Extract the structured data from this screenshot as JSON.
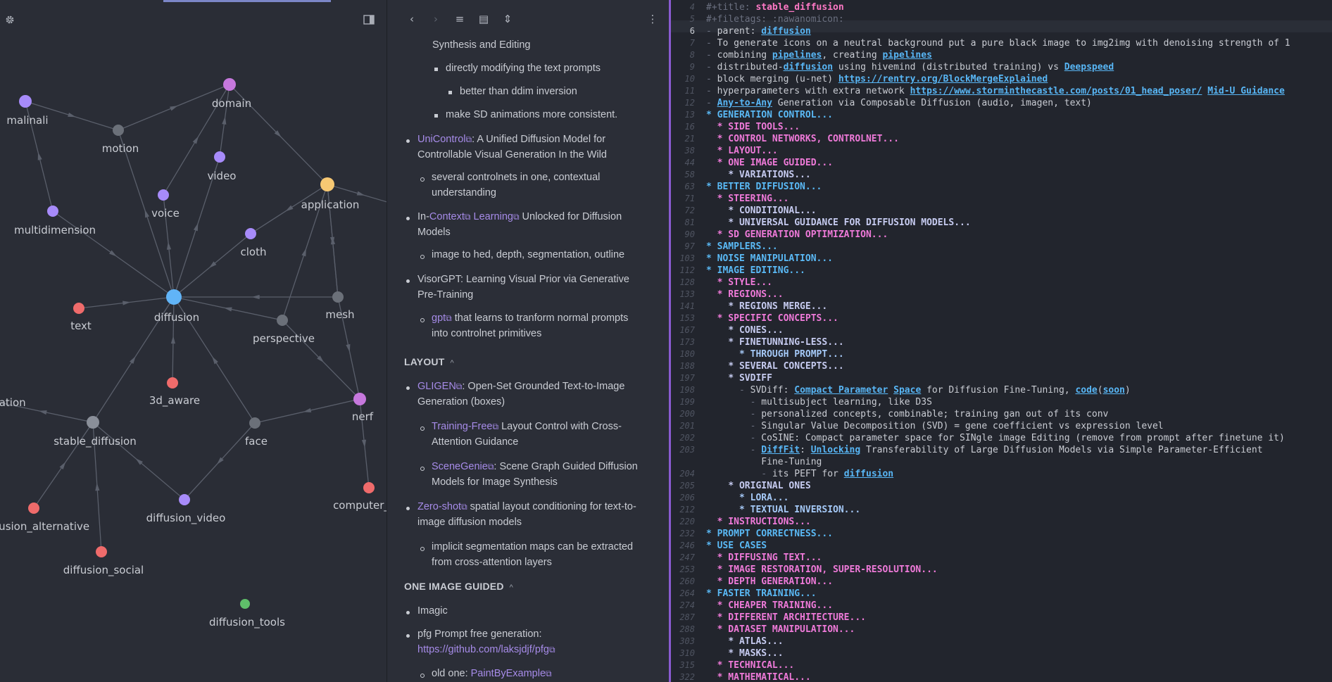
{
  "graph": {
    "settings_icon": "gear-icon",
    "sidebar_icon": "sidebar-toggle-icon",
    "nodes": [
      {
        "id": "malinali",
        "label": "malinali",
        "color": "#a78bfa"
      },
      {
        "id": "domain",
        "label": "domain",
        "color": "#c678dd"
      },
      {
        "id": "motion",
        "label": "motion",
        "color": "#6b7079"
      },
      {
        "id": "video",
        "label": "video",
        "color": "#a78bfa"
      },
      {
        "id": "voice",
        "label": "voice",
        "color": "#a78bfa"
      },
      {
        "id": "application",
        "label": "application",
        "color": "#f7c873"
      },
      {
        "id": "multidimension",
        "label": "multidimension",
        "color": "#a78bfa"
      },
      {
        "id": "cloth",
        "label": "cloth",
        "color": "#a78bfa"
      },
      {
        "id": "text",
        "label": "text",
        "color": "#ef6b6b"
      },
      {
        "id": "diffusion",
        "label": "diffusion",
        "color": "#61b4f7"
      },
      {
        "id": "mesh",
        "label": "mesh",
        "color": "#6b7079"
      },
      {
        "id": "perspective",
        "label": "perspective",
        "color": "#6b7079"
      },
      {
        "id": "3d_aware",
        "label": "3d_aware",
        "color": "#ef6b6b"
      },
      {
        "id": "ntation",
        "label": "ntation",
        "color": "#6b7079"
      },
      {
        "id": "nerf",
        "label": "nerf",
        "color": "#c678dd"
      },
      {
        "id": "stable_diffusion",
        "label": "stable_diffusion",
        "color": "#8a8f99"
      },
      {
        "id": "face",
        "label": "face",
        "color": "#6b7079"
      },
      {
        "id": "computer_illu",
        "label": "computer_illu",
        "color": "#ef6b6b"
      },
      {
        "id": "diffusion_video",
        "label": "diffusion_video",
        "color": "#a78bfa"
      },
      {
        "id": "fusion_alternative",
        "label": "fusion_alternative",
        "color": "#ef6b6b"
      },
      {
        "id": "diffusion_social",
        "label": "diffusion_social",
        "color": "#ef6b6b"
      },
      {
        "id": "diffusion_tools",
        "label": "diffusion_tools",
        "color": "#5fbf6a"
      }
    ]
  },
  "reader": {
    "toolbar": {
      "back": "‹",
      "forward": "›",
      "outline": "≡",
      "reading": "▤",
      "expand": "⇕",
      "more": "⋮"
    },
    "items": {
      "i1": "Synthesis and Editing",
      "i2": "directly modifying the text prompts",
      "i3": "better than ddim inversion",
      "i4": "make SD animations more consistent.",
      "i5_link": "UniControl",
      "i5_rest1": ": A Unified Diffusion Model for",
      "i5_rest2": "Controllable Visual Generation In the Wild",
      "i6a": "several controlnets in one, contextual",
      "i6b": "understanding",
      "i7_pre": "In-",
      "i7_link1": "Context",
      "i7_link2": "Learning",
      "i7_rest": " Unlocked for Diffusion",
      "i7_rest2": "Models",
      "i8": "image to hed, depth, segmentation, outline",
      "i9a": "VisorGPT: Learning Visual Prior via Generative",
      "i9b": "Pre-Training",
      "i10_link": "gpt",
      "i10_rest": " that learns to tranform normal prompts",
      "i10_rest2": "into controlnet primitives",
      "h_layout": "LAYOUT",
      "i11_link": "GLIGEN",
      "i11_rest": ": Open-Set Grounded Text-to-Image",
      "i11_rest2": "Generation (boxes)",
      "i12_link": "Training-Free",
      "i12_rest": " Layout Control with Cross-",
      "i12_rest2": "Attention Guidance",
      "i13_link": "SceneGenie",
      "i13_rest": ": Scene Graph Guided Diffusion",
      "i13_rest2": "Models for Image Synthesis",
      "i14_link": "Zero-shot",
      "i14_rest": " spatial layout conditioning for text-to-",
      "i14_rest2": "image diffusion models",
      "i15a": "implicit segmentation maps can be extracted",
      "i15b": "from cross-attention layers",
      "h_oneimage": "ONE IMAGE GUIDED",
      "i16": "Imagic",
      "i17a": "pfg Prompt free generation:",
      "i17_link": "https://github.com/laksjdjf/pfg",
      "i18_pre": "old one: ",
      "i18_link": "PaintByExample"
    }
  },
  "editor": {
    "active_line": "6",
    "lines": [
      {
        "n": "4",
        "t": "#+title: stable_diffusion"
      },
      {
        "n": "5",
        "t": "#+filetags: :nawanomicon:"
      },
      {
        "n": "6",
        "t": "- parent: diffusion"
      },
      {
        "n": "7",
        "t": "- To generate icons on a neutral background put a pure black image to img2img with denoising strength of 1"
      },
      {
        "n": "8",
        "t": "- combining pipelines, creating pipelines"
      },
      {
        "n": "9",
        "t": "- distributed-diffusion using hivemind (distributed training) vs Deepspeed"
      },
      {
        "n": "10",
        "t": "- block merging (u-net) https://rentry.org/BlockMergeExplained"
      },
      {
        "n": "11",
        "t": "- hyperparameters with extra network https://www.storminthecastle.com/posts/01_head_poser/ Mid-U Guidance"
      },
      {
        "n": "12",
        "t": "- Any-to-Any Generation via Composable Diffusion (audio, imagen, text)"
      },
      {
        "n": "13",
        "t": "* GENERATION CONTROL..."
      },
      {
        "n": "16",
        "t": "** SIDE TOOLS..."
      },
      {
        "n": "21",
        "t": "** CONTROL NETWORKS, CONTROLNET..."
      },
      {
        "n": "38",
        "t": "** LAYOUT..."
      },
      {
        "n": "44",
        "t": "** ONE IMAGE GUIDED..."
      },
      {
        "n": "58",
        "t": "*** VARIATIONS..."
      },
      {
        "n": "63",
        "t": "* BETTER DIFFUSION..."
      },
      {
        "n": "71",
        "t": "** STEERING..."
      },
      {
        "n": "72",
        "t": "*** CONDITIONAL..."
      },
      {
        "n": "81",
        "t": "*** UNIVERSAL GUIDANCE FOR DIFFUSION MODELS..."
      },
      {
        "n": "90",
        "t": "** SD GENERATION OPTIMIZATION..."
      },
      {
        "n": "97",
        "t": "* SAMPLERS..."
      },
      {
        "n": "103",
        "t": "* NOISE MANIPULATION..."
      },
      {
        "n": "112",
        "t": "* IMAGE EDITING..."
      },
      {
        "n": "128",
        "t": "** STYLE..."
      },
      {
        "n": "133",
        "t": "** REGIONS..."
      },
      {
        "n": "141",
        "t": "*** REGIONS MERGE..."
      },
      {
        "n": "153",
        "t": "** SPECIFIC CONCEPTS..."
      },
      {
        "n": "167",
        "t": "*** CONES..."
      },
      {
        "n": "173",
        "t": "*** FINETUNNING-LESS..."
      },
      {
        "n": "180",
        "t": "**** THROUGH PROMPT..."
      },
      {
        "n": "188",
        "t": "*** SEVERAL CONCEPTS..."
      },
      {
        "n": "197",
        "t": "*** SVDIFF"
      },
      {
        "n": "198",
        "t": "- SVDiff: Compact Parameter Space for Diffusion Fine-Tuning, code(soon)"
      },
      {
        "n": "199",
        "t": "- multisubject learning, like D3S"
      },
      {
        "n": "200",
        "t": "- personalized concepts, combinable; training gan out of its conv"
      },
      {
        "n": "201",
        "t": "- Singular Value Decomposition (SVD) = gene coefficient vs expression level"
      },
      {
        "n": "202",
        "t": "- CoSINE: Compact parameter space for SINgle image Editing (remove from prompt after finetune it)"
      },
      {
        "n": "203",
        "t": "- DiffFit: Unlocking Transferability of Large Diffusion Models via Simple Parameter-Efficient"
      },
      {
        "n": "",
        "t": "Fine-Tuning"
      },
      {
        "n": "204",
        "t": "- its PEFT for diffusion"
      },
      {
        "n": "205",
        "t": "*** ORIGINAL ONES"
      },
      {
        "n": "206",
        "t": "**** LORA..."
      },
      {
        "n": "212",
        "t": "**** TEXTUAL INVERSION..."
      },
      {
        "n": "220",
        "t": "** INSTRUCTIONS..."
      },
      {
        "n": "232",
        "t": "* PROMPT CORRECTNESS..."
      },
      {
        "n": "246",
        "t": "* USE CASES"
      },
      {
        "n": "247",
        "t": "** DIFFUSING TEXT..."
      },
      {
        "n": "253",
        "t": "** IMAGE RESTORATION, SUPER-RESOLUTION..."
      },
      {
        "n": "260",
        "t": "** DEPTH GENERATION..."
      },
      {
        "n": "264",
        "t": "* FASTER TRAINING..."
      },
      {
        "n": "274",
        "t": "** CHEAPER TRAINING..."
      },
      {
        "n": "287",
        "t": "** DIFFERENT ARCHITECTURE..."
      },
      {
        "n": "288",
        "t": "** DATASET MANIPULATION..."
      },
      {
        "n": "303",
        "t": "*** ATLAS..."
      },
      {
        "n": "310",
        "t": "*** MASKS..."
      },
      {
        "n": "315",
        "t": "** TECHNICAL..."
      },
      {
        "n": "322",
        "t": "** MATHEMATICAL..."
      }
    ]
  }
}
